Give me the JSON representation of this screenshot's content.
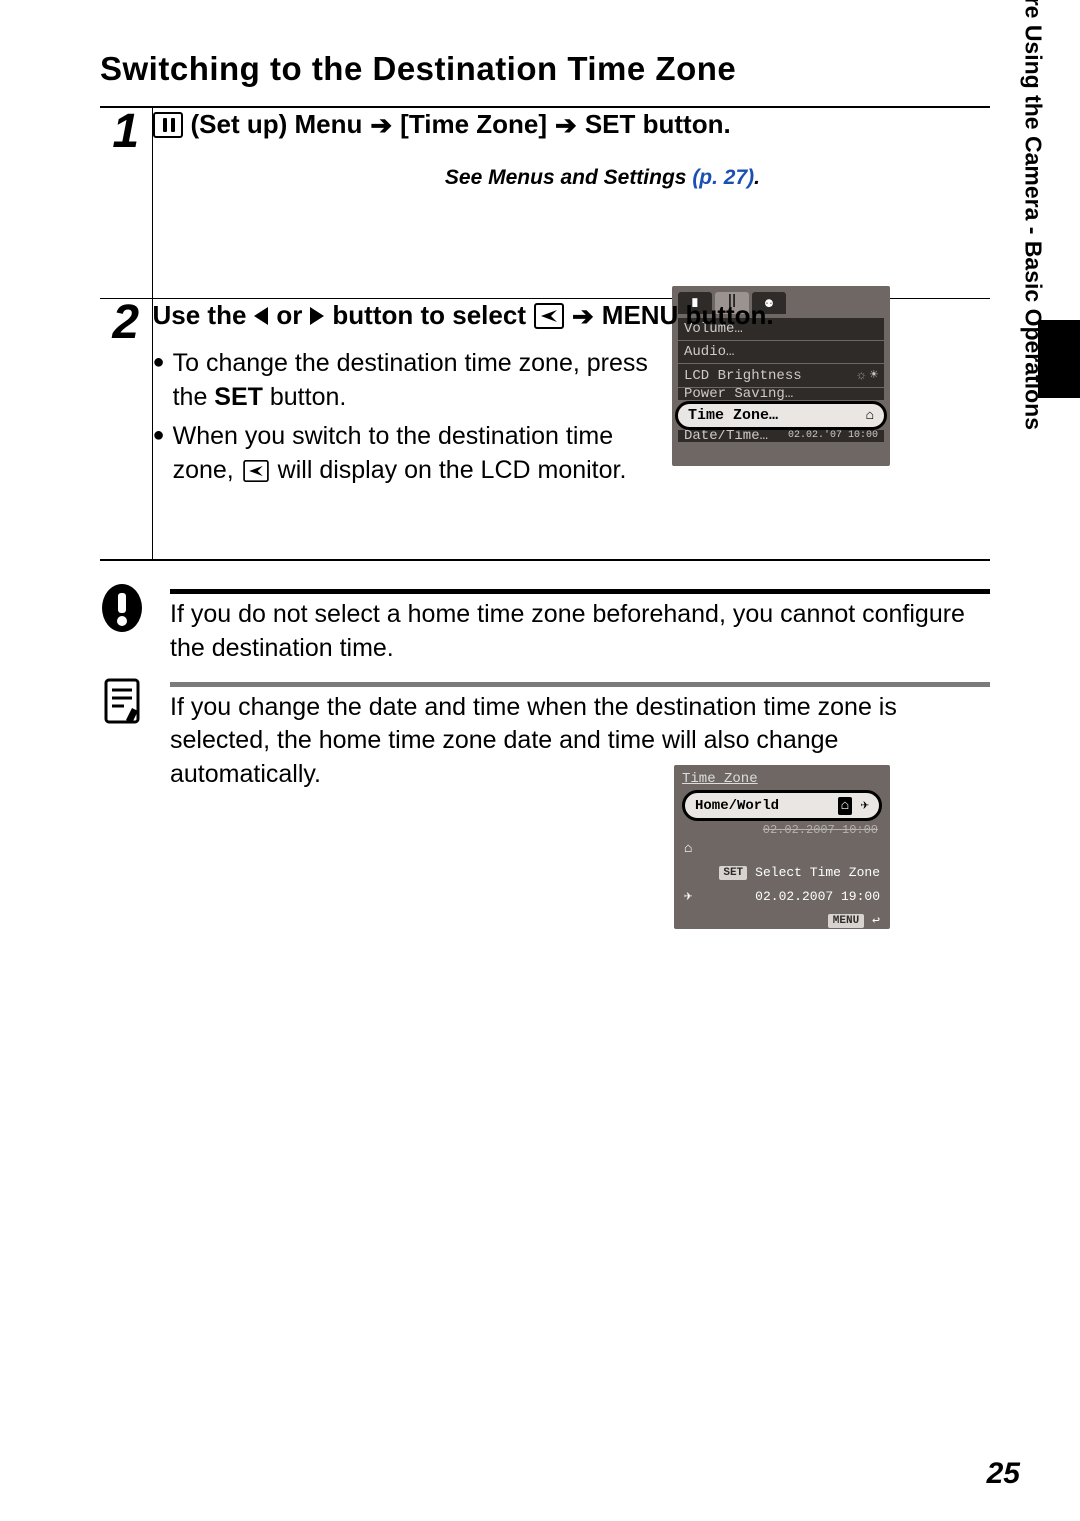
{
  "title": "Switching to the Destination Time Zone",
  "steps": [
    {
      "num": "1",
      "heading": {
        "pre_icon": "(Set up) Menu",
        "mid": "[Time Zone]",
        "tail": "SET button."
      },
      "ref_text": "See Menus and Settings ",
      "ref_link": "(p. 27)",
      "ref_period": "."
    },
    {
      "num": "2",
      "heading": {
        "a": "Use the",
        "b": "or",
        "c": "button to select",
        "d": "MENU button."
      },
      "bullets": [
        {
          "parts": [
            "To change the destination time zone, press the ",
            "SET",
            " button."
          ]
        },
        {
          "parts": [
            "When you switch to the destination time zone, ",
            " will display on the LCD monitor."
          ]
        }
      ]
    }
  ],
  "notes": {
    "warn": "If you do not select a home time zone beforehand, you cannot configure the destination time.",
    "memo": "If you change the date and time when the destination time zone is selected, the home time zone date and time will also change automatically."
  },
  "lcd1": {
    "items": {
      "volume": "Volume…",
      "audio": "Audio…",
      "lcd": "LCD Brightness",
      "power": "Power Saving…",
      "timezone": "Time Zone…",
      "datetime": "Date/Time…"
    },
    "datetime_value": "02.02.'07 10:00"
  },
  "lcd2": {
    "title": "Time Zone",
    "homeworld": "Home/World",
    "date1": "02.02.2007 10:00",
    "select_tz": "Select Time Zone",
    "date2": "02.02.2007 19:00",
    "menu": "MENU",
    "set": "SET"
  },
  "side_label": "Before Using the Camera - Basic Operations",
  "page_number": "25"
}
